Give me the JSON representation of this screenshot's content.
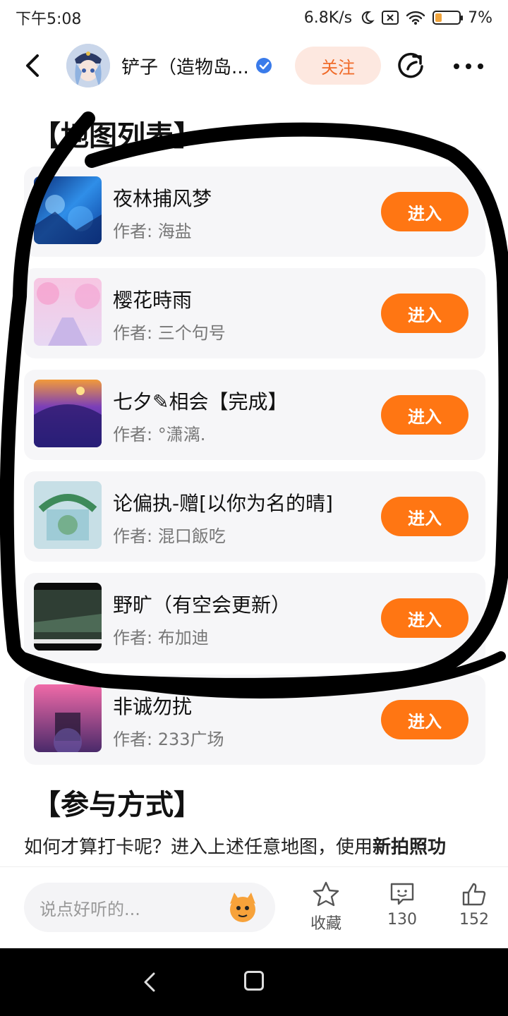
{
  "status_bar": {
    "time": "下午5:08",
    "speed": "6.8K/s",
    "battery": "7%",
    "battery_level": 0.07
  },
  "header": {
    "author": "铲子（造物岛...",
    "follow_label": "关注"
  },
  "sections": {
    "map_list_title": "【地图列表】",
    "participation_title": "【参与方式】"
  },
  "maps": [
    {
      "title": "夜林捕风梦",
      "author": "作者: 海盐",
      "enter_label": "进入"
    },
    {
      "title": "樱花時雨",
      "author": "作者: 三个句号",
      "enter_label": "进入"
    },
    {
      "title": "七夕✎相会【完成】",
      "author": "作者: °潇漓.",
      "enter_label": "进入"
    },
    {
      "title": "论偏执-赠[以你为名的晴]",
      "author": "作者: 混口飯吃",
      "enter_label": "进入"
    },
    {
      "title": "野旷（有空会更新）",
      "author": "作者: 布加迪",
      "enter_label": "进入"
    },
    {
      "title": "非诚勿扰",
      "author": "作者: 233广场",
      "enter_label": "进入"
    }
  ],
  "body": {
    "text_prefix": "如何才算打卡呢？进入上述任意地图，使用",
    "text_bold": "新拍照功"
  },
  "bottom_bar": {
    "comment_placeholder": "说点好听的...",
    "favorite_label": "收藏",
    "comment_count": "130",
    "like_count": "152"
  },
  "colors": {
    "accent": "#ff7613",
    "follow_text": "#f06a28",
    "follow_bg": "#fde8e0",
    "verified": "#3a7bea"
  }
}
